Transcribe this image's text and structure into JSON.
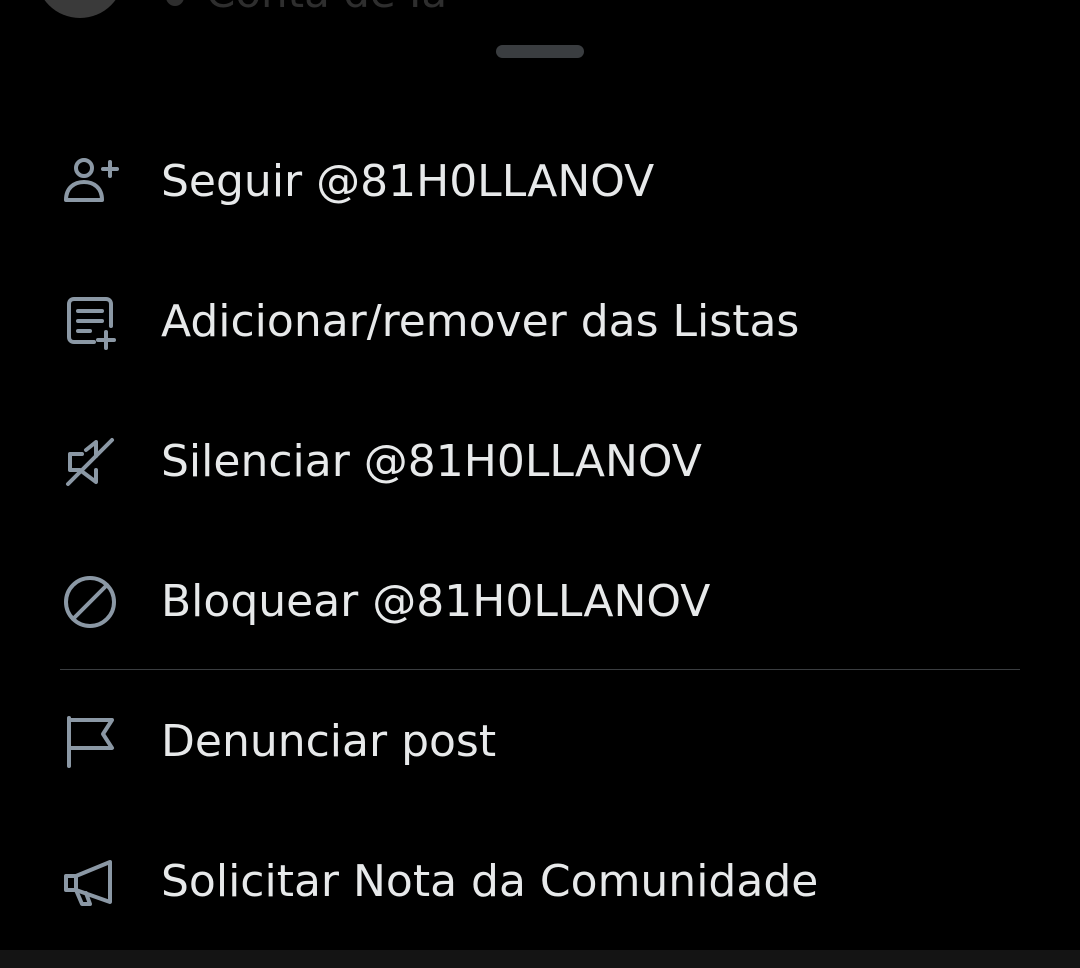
{
  "colors": {
    "background": "#000000",
    "text": "#e7e9ea",
    "icon": "#8b98a5",
    "divider": "#3a3d40",
    "handle": "#3a3d40"
  },
  "behind": {
    "text": "Conta de Ia"
  },
  "menu": {
    "items": [
      {
        "icon": "person-add-icon",
        "label": "Seguir @81H0LLANOV"
      },
      {
        "icon": "list-add-icon",
        "label": "Adicionar/remover das Listas"
      },
      {
        "icon": "speaker-muted-icon",
        "label": "Silenciar @81H0LLANOV"
      },
      {
        "icon": "block-icon",
        "label": "Bloquear @81H0LLANOV"
      },
      {
        "icon": "flag-icon",
        "label": "Denunciar post"
      },
      {
        "icon": "megaphone-icon",
        "label": "Solicitar Nota da Comunidade"
      }
    ]
  }
}
